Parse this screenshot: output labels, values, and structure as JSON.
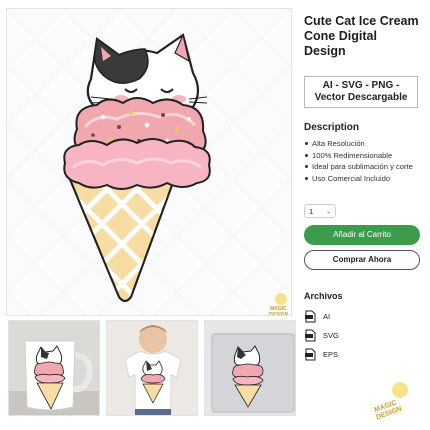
{
  "product": {
    "title": "Cute Cat Ice Cream Cone Digital Design",
    "formats_badge": "AI - SVG - PNG - Vector Descargable"
  },
  "description": {
    "heading": "Description",
    "items": [
      "Alta Resolución",
      "100% Redimensionable",
      "Ideal para sublimación y corte",
      "Uso Comercial Incluido"
    ]
  },
  "purchase": {
    "quantity": "1",
    "add_to_cart_label": "Añadir al Carrito",
    "buy_now_label": "Comprar Ahora",
    "add_to_cart_color": "#3c9c4b"
  },
  "files": {
    "heading": "Archivos",
    "items": [
      "AI",
      "SVG",
      "EPS"
    ]
  },
  "watermark": {
    "text_top": "MAGIC",
    "text_bottom": "DESIGN"
  },
  "thumbnails": [
    {
      "name": "mug-mockup"
    },
    {
      "name": "tshirt-mockup"
    },
    {
      "name": "laptop-sticker-mockup"
    }
  ]
}
